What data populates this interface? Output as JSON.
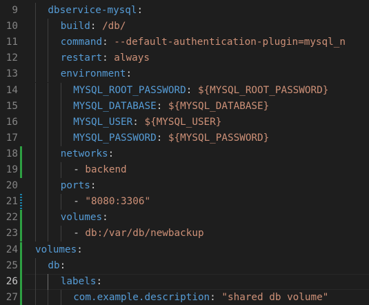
{
  "editor": {
    "active_line": "26",
    "lines": [
      {
        "num": "9",
        "indent": 1,
        "key": "dbservice-mysql",
        "colon": ":",
        "value": "",
        "dash": false,
        "marker": ""
      },
      {
        "num": "10",
        "indent": 2,
        "key": "build",
        "colon": ": ",
        "value": "/db/",
        "dash": false,
        "marker": ""
      },
      {
        "num": "11",
        "indent": 2,
        "key": "command",
        "colon": ": ",
        "value": "--default-authentication-plugin=mysql_n",
        "dash": false,
        "marker": ""
      },
      {
        "num": "12",
        "indent": 2,
        "key": "restart",
        "colon": ": ",
        "value": "always",
        "dash": false,
        "marker": ""
      },
      {
        "num": "13",
        "indent": 2,
        "key": "environment",
        "colon": ":",
        "value": "",
        "dash": false,
        "marker": ""
      },
      {
        "num": "14",
        "indent": 3,
        "key": "MYSQL_ROOT_PASSWORD",
        "colon": ": ",
        "value": "${MYSQL_ROOT_PASSWORD}",
        "dash": false,
        "marker": ""
      },
      {
        "num": "15",
        "indent": 3,
        "key": "MYSQL_DATABASE",
        "colon": ": ",
        "value": "${MYSQL_DATABASE}",
        "dash": false,
        "marker": ""
      },
      {
        "num": "16",
        "indent": 3,
        "key": "MYSQL_USER",
        "colon": ": ",
        "value": "${MYSQL_USER}",
        "dash": false,
        "marker": ""
      },
      {
        "num": "17",
        "indent": 3,
        "key": "MYSQL_PASSWORD",
        "colon": ": ",
        "value": "${MYSQL_PASSWORD}",
        "dash": false,
        "marker": ""
      },
      {
        "num": "18",
        "indent": 2,
        "key": "networks",
        "colon": ":",
        "value": "",
        "dash": false,
        "marker": "added"
      },
      {
        "num": "19",
        "indent": 3,
        "key": "",
        "colon": "",
        "value": "backend",
        "dash": true,
        "marker": "added"
      },
      {
        "num": "20",
        "indent": 2,
        "key": "ports",
        "colon": ":",
        "value": "",
        "dash": false,
        "marker": ""
      },
      {
        "num": "21",
        "indent": 3,
        "key": "",
        "colon": "",
        "value": "\"8080:3306\"",
        "dash": true,
        "marker": "modified"
      },
      {
        "num": "22",
        "indent": 2,
        "key": "volumes",
        "colon": ":",
        "value": "",
        "dash": false,
        "marker": "added"
      },
      {
        "num": "23",
        "indent": 3,
        "key": "",
        "colon": "",
        "value": "db:/var/db/newbackup",
        "dash": true,
        "marker": "added"
      },
      {
        "num": "24",
        "indent": 0,
        "key": "volumes",
        "colon": ":",
        "value": "",
        "dash": false,
        "marker": "added"
      },
      {
        "num": "25",
        "indent": 1,
        "key": "db",
        "colon": ":",
        "value": "",
        "dash": false,
        "marker": "added"
      },
      {
        "num": "26",
        "indent": 2,
        "key": "labels",
        "colon": ":",
        "value": "",
        "dash": false,
        "marker": "added"
      },
      {
        "num": "27",
        "indent": 3,
        "key": "com.example.description",
        "colon": ": ",
        "value": "\"shared db volume\"",
        "dash": false,
        "marker": "added"
      }
    ]
  },
  "colors": {
    "background": "#1e1e1e",
    "line_number": "#858585",
    "line_number_active": "#c6c6c6",
    "yaml_key": "#569cd6",
    "yaml_value": "#ce9178",
    "punctuation": "#d4d4d4",
    "gutter_added": "#2ea043",
    "gutter_modified": "#1b81a8"
  }
}
